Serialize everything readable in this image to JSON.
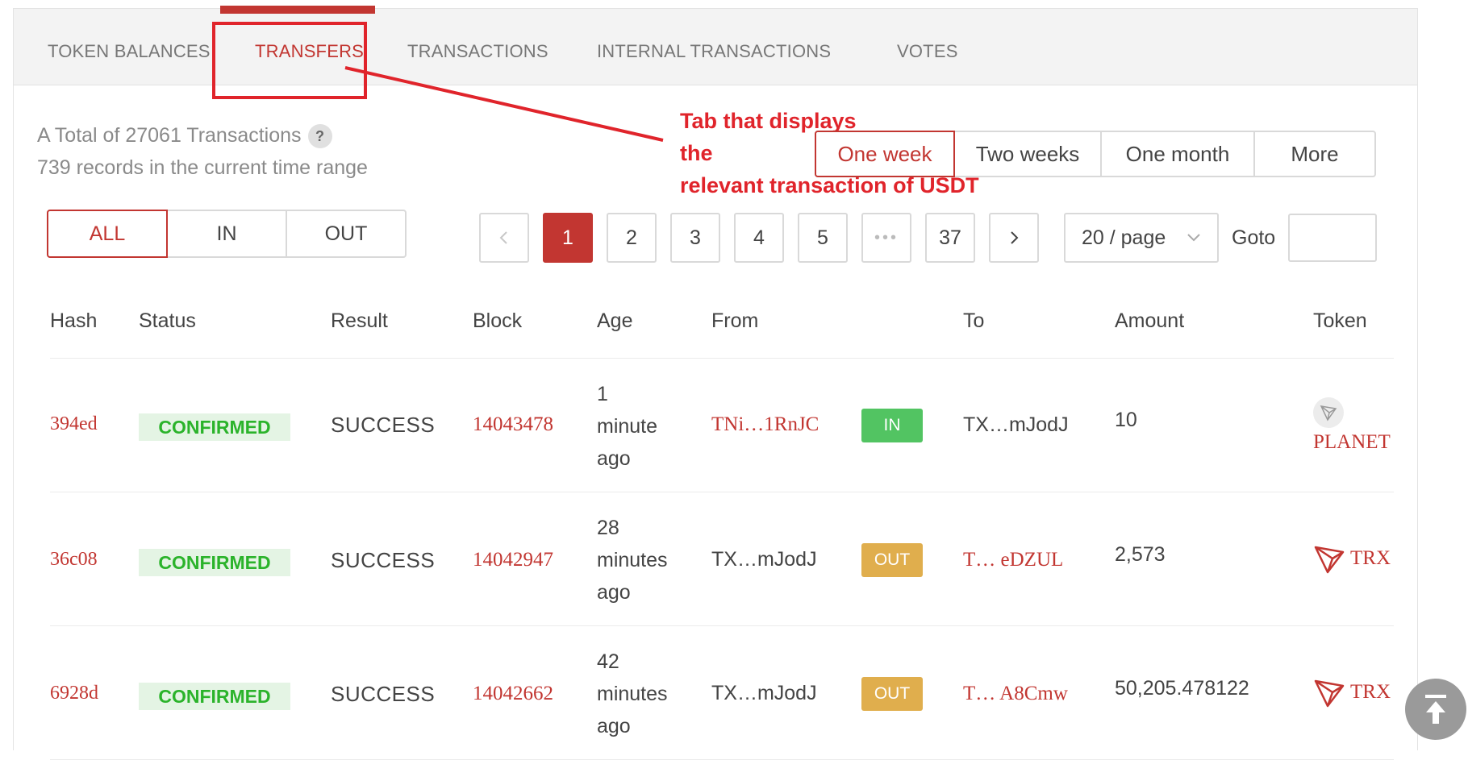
{
  "tabs": [
    {
      "label": "TOKEN BALANCES"
    },
    {
      "label": "TRANSFERS"
    },
    {
      "label": "TRANSACTIONS"
    },
    {
      "label": "INTERNAL TRANSACTIONS"
    },
    {
      "label": "VOTES"
    }
  ],
  "summary": {
    "total": "A Total of 27061 Transactions",
    "help": "?",
    "range_records": "739 records in the current time range"
  },
  "time_range": {
    "options": [
      "One week",
      "Two weeks",
      "One month",
      "More"
    ],
    "selected": "One week"
  },
  "direction_filter": {
    "options": [
      "ALL",
      "IN",
      "OUT"
    ],
    "selected": "ALL"
  },
  "pagination": {
    "prev": "<",
    "pages": [
      "1",
      "2",
      "3",
      "4",
      "5"
    ],
    "ellipsis": "•••",
    "last": "37",
    "next": ">",
    "current": "1",
    "page_size": "20 / page",
    "goto_label": "Goto",
    "goto_value": ""
  },
  "table": {
    "headers": [
      "Hash",
      "Status",
      "Result",
      "Block",
      "Age",
      "From",
      "To",
      "Amount",
      "Token"
    ],
    "rows": [
      {
        "hash": "394ed",
        "status": "CONFIRMED",
        "result": "SUCCESS",
        "block": "14043478",
        "age": [
          "1",
          "minute",
          "ago"
        ],
        "from": "TNi…1RnJC",
        "direction": "IN",
        "to": "TX…mJodJ",
        "amount": "10",
        "token": "PLANET",
        "token_icon": "planet-token-icon"
      },
      {
        "hash": "36c08",
        "status": "CONFIRMED",
        "result": "SUCCESS",
        "block": "14042947",
        "age": [
          "28",
          "minutes",
          "ago"
        ],
        "from": "TX…mJodJ",
        "direction": "OUT",
        "to": "T…  eDZUL",
        "amount": "2,573",
        "token": "TRX",
        "token_icon": "trx-logo-icon"
      },
      {
        "hash": "6928d",
        "status": "CONFIRMED",
        "result": "SUCCESS",
        "block": "14042662",
        "age": [
          "42",
          "minutes",
          "ago"
        ],
        "from": "TX…mJodJ",
        "direction": "OUT",
        "to": "T… A8Cmw",
        "amount": "50,205.478122",
        "token": "TRX",
        "token_icon": "trx-logo-icon"
      }
    ]
  },
  "annotation": {
    "lines": [
      "Tab that displays",
      "the",
      "relevant transaction of USDT"
    ],
    "color": "#e0242b"
  },
  "colors": {
    "accent": "#c23631",
    "in_badge": "#52c462",
    "out_badge": "#e0ae4d",
    "confirmed": "#2bb32b"
  }
}
